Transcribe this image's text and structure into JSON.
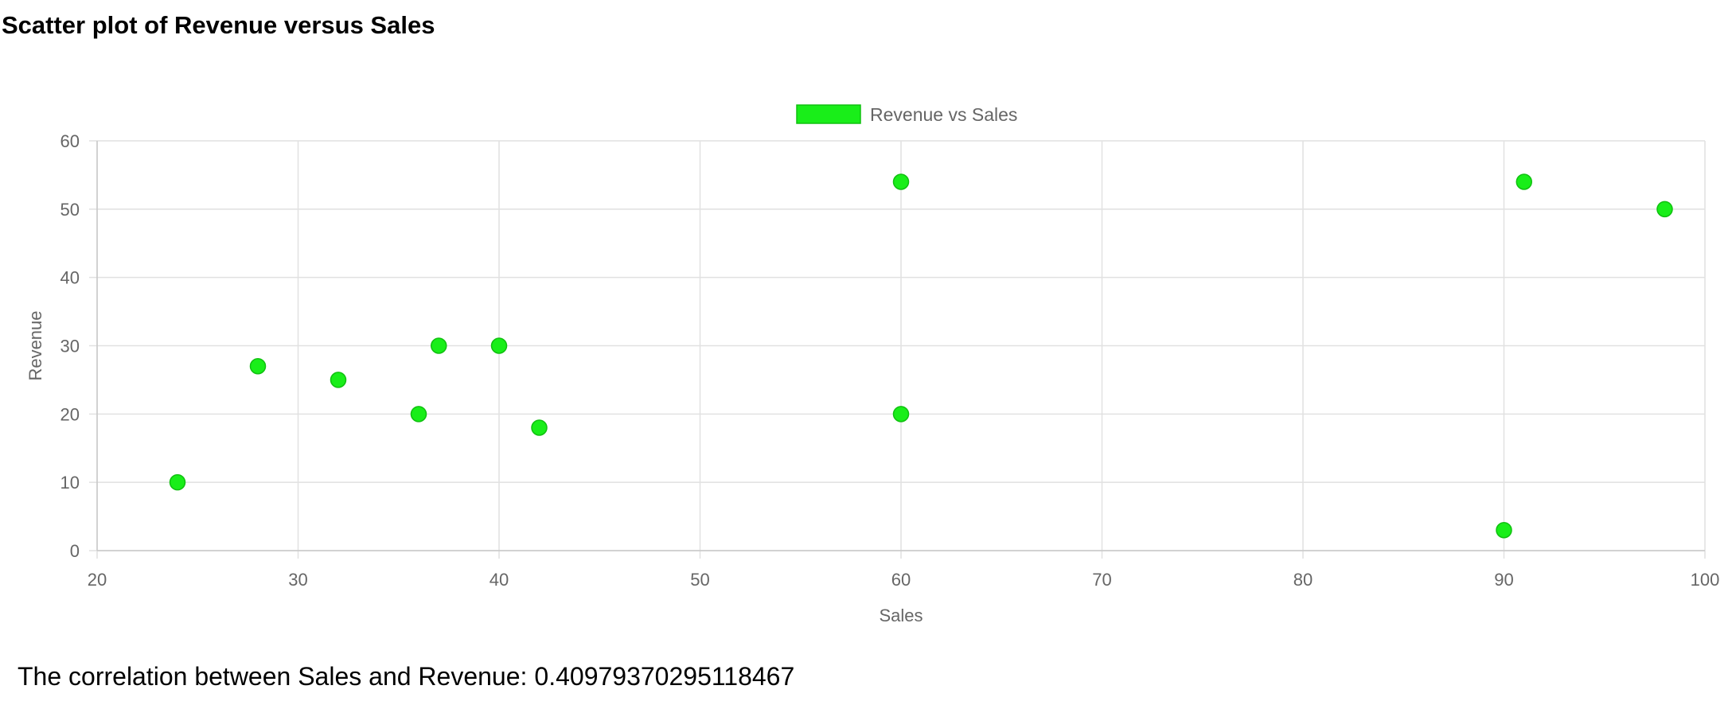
{
  "page": {
    "title": "Scatter plot of Revenue versus Sales",
    "correlation_label": "The correlation between Sales and Revenue:",
    "correlation_value": "0.40979370295118467"
  },
  "chart_data": {
    "type": "scatter",
    "title": "",
    "xlabel": "Sales",
    "ylabel": "Revenue",
    "xlim": [
      20,
      100
    ],
    "ylim": [
      0,
      60
    ],
    "xticks": [
      20,
      30,
      40,
      50,
      60,
      70,
      80,
      90,
      100
    ],
    "yticks": [
      0,
      10,
      20,
      30,
      40,
      50,
      60
    ],
    "grid": true,
    "legend": {
      "position": "top-center"
    },
    "series": [
      {
        "name": "Revenue vs Sales",
        "color": "#19ee19",
        "border_color": "#10c010",
        "points": [
          {
            "x": 24,
            "y": 10
          },
          {
            "x": 28,
            "y": 27
          },
          {
            "x": 32,
            "y": 25
          },
          {
            "x": 36,
            "y": 20
          },
          {
            "x": 37,
            "y": 30
          },
          {
            "x": 40,
            "y": 30
          },
          {
            "x": 42,
            "y": 18
          },
          {
            "x": 60,
            "y": 54
          },
          {
            "x": 60,
            "y": 20
          },
          {
            "x": 90,
            "y": 3
          },
          {
            "x": 91,
            "y": 54
          },
          {
            "x": 98,
            "y": 50
          }
        ]
      }
    ]
  }
}
